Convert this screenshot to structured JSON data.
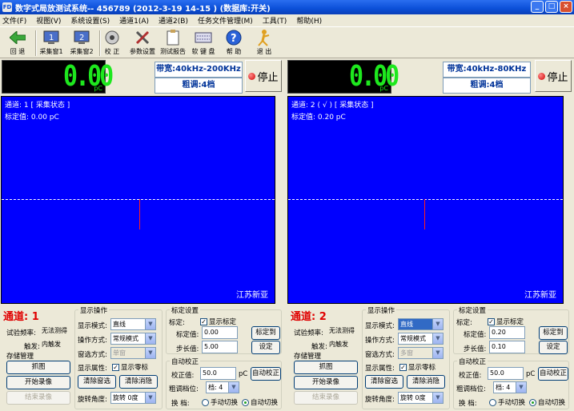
{
  "window": {
    "title": "数字式局放测试系统--   456789  (2012-3-19     14-15 )     (数据库:开关)",
    "app_icon": "FD",
    "min": "_",
    "max": "□",
    "close": "×"
  },
  "menu": [
    "文件(F)",
    "视图(V)",
    "系统设置(S)",
    "通道1(A)",
    "通道2(B)",
    "任务文件管理(M)",
    "工具(T)",
    "帮助(H)"
  ],
  "toolbar": [
    {
      "label": "回  退",
      "icon": "arrow-left-icon"
    },
    {
      "label": "采集窗1",
      "icon": "monitor-1-icon"
    },
    {
      "label": "采集窗2",
      "icon": "monitor-2-icon"
    },
    {
      "label": "校  正",
      "icon": "disc-icon"
    },
    {
      "label": "参数设置",
      "icon": "tools-icon"
    },
    {
      "label": "测试报告",
      "icon": "clipboard-icon"
    },
    {
      "label": "软 键 盘",
      "icon": "keyboard-icon"
    },
    {
      "label": "帮  助",
      "icon": "help-icon"
    },
    {
      "label": "退  出",
      "icon": "exit-icon"
    }
  ],
  "channels": [
    {
      "lcd": "0.00",
      "unit": "pC",
      "bandwidth": "带宽:40kHz-200KHz",
      "coarse": "粗调:4档",
      "stop": "停止",
      "scope_line1": "通道: 1 [ 采集状态 ]",
      "scope_line2": "标定值: 0.00 pC",
      "brand": "江苏新亚",
      "chan_label": "通道: 1",
      "test_freq_label": "试验频率:",
      "test_freq": "无法测得",
      "trigger_label": "触发:",
      "trigger": "内触发",
      "storage": "存储管理",
      "capture": "抓图",
      "start_rec": "开始录像",
      "end_rec": "结束录像",
      "disp_group": "显示操作",
      "disp_mode_label": "显示模式:",
      "disp_mode": "直线",
      "op_mode_label": "操作方式:",
      "op_mode": "常规模式",
      "win_label": "窗选方式:",
      "win": "单窗",
      "attr_label": "显示属性:",
      "show_zero": "显示零标",
      "clear_win": "清除窗选",
      "clear_noise": "清除消隐",
      "rot_label": "旋转角度:",
      "rot": "旋转 0度",
      "cal_group": "标定设置",
      "cal_label": "标定:",
      "show_cal": "显示标定",
      "cal_val_label": "标定值:",
      "cal_val": "0.00",
      "cal_btn": "标定到",
      "step_label": "步长值:",
      "step": "5.00",
      "set_btn": "设定",
      "auto_group": "自动校正",
      "corr_label": "校正值:",
      "corr": "50.0",
      "corr_unit": "pC",
      "auto_btn": "自动校正",
      "coarse_pos_label": "粗调档位:",
      "coarse_pos": "档: 4",
      "switch_label": "换   档:",
      "manual": "手动切换",
      "auto": "自动切换"
    },
    {
      "lcd": "0.00",
      "unit": "pC",
      "bandwidth": "带宽:40kHz-80KHz",
      "coarse": "粗调:4档",
      "stop": "停止",
      "scope_line1": "通道: 2 ( √ ) [ 采集状态 ]",
      "scope_line2": "标定值: 0.20 pC",
      "brand": "江苏新亚",
      "chan_label": "通道: 2",
      "test_freq_label": "试验频率:",
      "test_freq": "无法测得",
      "trigger_label": "触发:",
      "trigger": "内触发",
      "storage": "存储管理",
      "capture": "抓图",
      "start_rec": "开始录像",
      "end_rec": "结束录像",
      "disp_group": "显示操作",
      "disp_mode_label": "显示模式:",
      "disp_mode": "直线",
      "op_mode_label": "操作方式:",
      "op_mode": "常规模式",
      "win_label": "窗选方式:",
      "win": "多窗",
      "attr_label": "显示属性:",
      "show_zero": "显示零标",
      "clear_win": "清除窗选",
      "clear_noise": "清除消隐",
      "rot_label": "旋转角度:",
      "rot": "旋转 0度",
      "cal_group": "标定设置",
      "cal_label": "标定:",
      "show_cal": "显示标定",
      "cal_val_label": "标定值:",
      "cal_val": "0.20",
      "cal_btn": "标定到",
      "step_label": "步长值:",
      "step": "0.10",
      "set_btn": "设定",
      "auto_group": "自动校正",
      "corr_label": "校正值:",
      "corr": "50.0",
      "corr_unit": "pC",
      "auto_btn": "自动校正",
      "coarse_pos_label": "粗调档位:",
      "coarse_pos": "档: 4",
      "switch_label": "换   档:",
      "manual": "手动切换",
      "auto": "自动切换"
    }
  ]
}
